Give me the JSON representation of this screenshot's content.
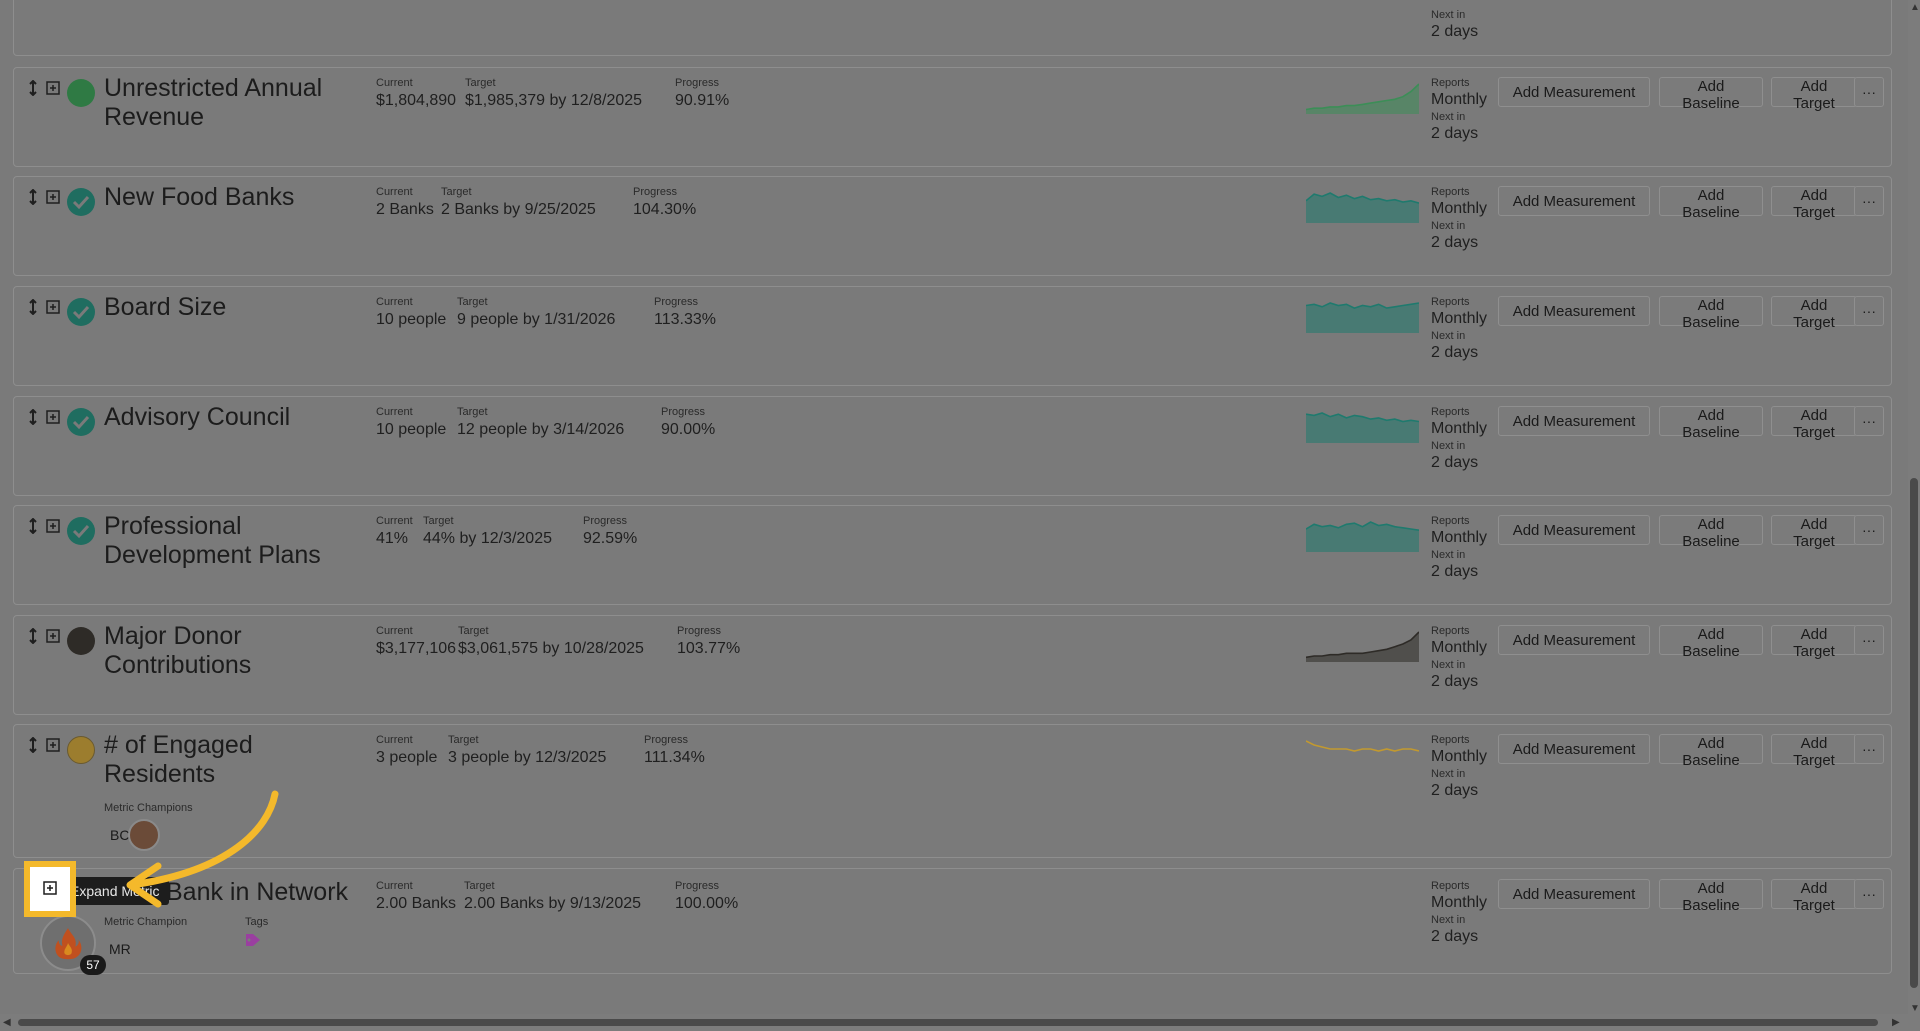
{
  "labels": {
    "current": "Current",
    "target": "Target",
    "progress": "Progress",
    "reports": "Reports",
    "next_in": "Next in",
    "metric_champions": "Metric Champions",
    "metric_champion": "Metric Champion",
    "tags": "Tags"
  },
  "buttons": {
    "add_measurement": "Add Measurement",
    "add_baseline": "Add Baseline",
    "add_target": "Add Target",
    "more": "···"
  },
  "top_partial": {
    "next_in_value": "2 days"
  },
  "metrics": [
    {
      "title": "Unrestricted Annual Revenue",
      "status": "green-dot",
      "status_color": "#2f9a4e",
      "current": "$1,804,890",
      "target": "$1,985,379 by 12/8/2025",
      "progress": "90.91%",
      "frequency": "Monthly",
      "next_in": "2 days",
      "spark_color": "#3c8e57",
      "spark": [
        2,
        3,
        3,
        4,
        4,
        5,
        5,
        6,
        7,
        8,
        9,
        10,
        12,
        16,
        22
      ]
    },
    {
      "title": "New Food Banks",
      "status": "check-icon",
      "status_color": "#1f7a6e",
      "current": "2 Banks",
      "target": "2 Banks by 9/25/2025",
      "progress": "104.30%",
      "frequency": "Monthly",
      "next_in": "2 days",
      "spark_color": "#1f7a6e",
      "spark": [
        18,
        24,
        22,
        25,
        21,
        23,
        20,
        22,
        19,
        20,
        18,
        19,
        17,
        18,
        16
      ]
    },
    {
      "title": "Board Size",
      "status": "check-icon",
      "status_color": "#1f7a6e",
      "current": "10 people",
      "target": "9 people by 1/31/2026",
      "progress": "113.33%",
      "frequency": "Monthly",
      "next_in": "2 days",
      "spark_color": "#1f7a6e",
      "spark": [
        20,
        21,
        19,
        22,
        20,
        21,
        18,
        20,
        19,
        21,
        18,
        19,
        20,
        21,
        22
      ]
    },
    {
      "title": "Advisory Council",
      "status": "check-icon",
      "status_color": "#1f7a6e",
      "current": "10 people",
      "target": "12 people by 3/14/2026",
      "progress": "90.00%",
      "frequency": "Monthly",
      "next_in": "2 days",
      "spark_color": "#1f7a6e",
      "spark": [
        22,
        21,
        23,
        20,
        22,
        19,
        21,
        20,
        18,
        19,
        17,
        18,
        16,
        17,
        16
      ]
    },
    {
      "title": "Professional Development Plans",
      "status": "check-icon",
      "status_color": "#1f7a6e",
      "current": "41%",
      "target": "44% by 12/3/2025",
      "progress": "92.59%",
      "frequency": "Monthly",
      "next_in": "2 days",
      "spark_color": "#1f7a6e",
      "spark": [
        18,
        22,
        20,
        21,
        19,
        22,
        23,
        20,
        24,
        21,
        22,
        20,
        19,
        18,
        17
      ]
    },
    {
      "title": "Major Donor Contributions",
      "status": "dark-dot",
      "status_color": "#2e2b27",
      "current": "$3,177,106",
      "target": "$3,061,575 by 10/28/2025",
      "progress": "103.77%",
      "frequency": "Monthly",
      "next_in": "2 days",
      "spark_color": "#2e2b27",
      "spark": [
        2,
        3,
        3,
        4,
        4,
        5,
        5,
        5,
        6,
        7,
        8,
        10,
        12,
        15,
        21
      ]
    },
    {
      "title": "# of Engaged Residents",
      "status": "gold-dot",
      "status_color": "#b49236",
      "current": "3 people",
      "target": "3 people by 12/3/2025",
      "progress": "111.34%",
      "frequency": "Monthly",
      "next_in": "2 days",
      "spark_color": "#c2992f",
      "spark": [
        14,
        12,
        11,
        10,
        10,
        10,
        9,
        10,
        10,
        9,
        10,
        9,
        10,
        10,
        9
      ],
      "champions_label": "Metric Champions",
      "champion_initials": "BC"
    },
    {
      "title": "Bank in Network",
      "status": "none",
      "current": "2.00 Banks",
      "target": "2.00 Banks by 9/13/2025",
      "progress": "100.00%",
      "frequency": "Monthly",
      "next_in": "2 days",
      "champion_label": "Metric Champion",
      "champion_initials": "MR",
      "tags_label": "Tags"
    }
  ],
  "tooltip": {
    "text": "Expand Metric"
  },
  "fire_badge": {
    "count": "57"
  },
  "colors": {
    "highlight": "#f4b92b",
    "overlay": "#7a7a7a"
  }
}
